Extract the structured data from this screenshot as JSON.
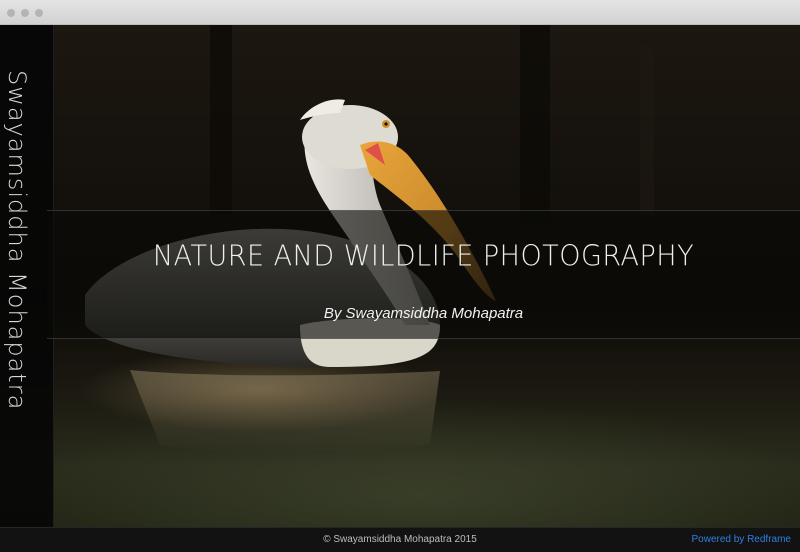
{
  "window": {
    "controls": [
      "close-dot",
      "minimize-dot",
      "maximize-dot"
    ]
  },
  "sidebar": {
    "name": "Swayamsiddha Mohapatra"
  },
  "hero": {
    "title": "NATURE AND WILDLIFE PHOTOGRAPHY",
    "subtitle": "By Swayamsiddha Mohapatra"
  },
  "footer": {
    "copyright": "© Swayamsiddha Mohapatra 2015",
    "powered_by": "Powered by Redframe"
  },
  "colors": {
    "link": "#2f7fe0",
    "panel": "#060606",
    "text": "#efefef"
  }
}
